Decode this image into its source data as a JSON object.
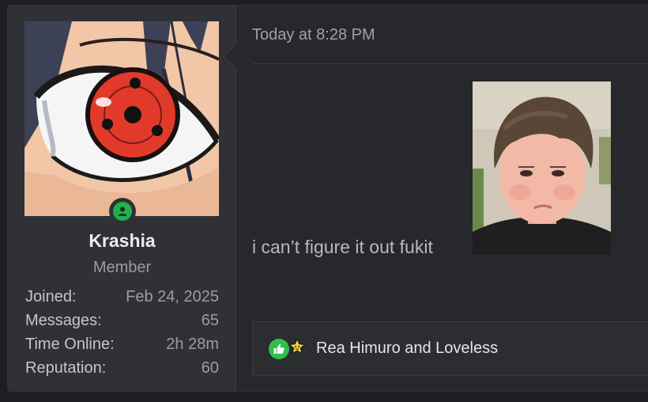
{
  "post": {
    "user": {
      "name": "Krashia",
      "title": "Member",
      "stats": [
        {
          "label": "Joined:",
          "value": "Feb 24, 2025"
        },
        {
          "label": "Messages:",
          "value": "65"
        },
        {
          "label": "Time Online:",
          "value": "2h 28m"
        },
        {
          "label": "Reputation:",
          "value": "60"
        }
      ],
      "online_color": "#20b14a"
    },
    "timestamp": "Today at 8:28 PM",
    "message": "i can’t figure it out fukit",
    "reactions": {
      "icons": [
        "thumbs-up-icon",
        "star-icon"
      ],
      "text": "Rea Himuro and Loveless"
    }
  }
}
